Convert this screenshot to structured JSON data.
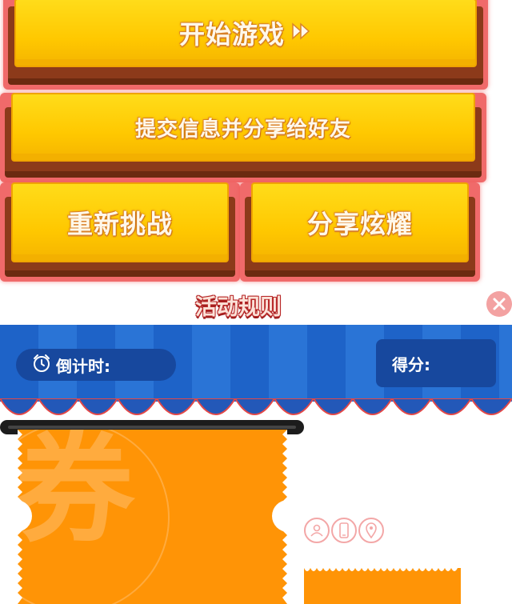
{
  "buttons": {
    "start_game": "开始游戏",
    "submit_share": "提交信息并分享给好友",
    "retry": "重新挑战",
    "share_show": "分享炫耀"
  },
  "rules_link": "活动规则",
  "header": {
    "timer_label": "倒计时:",
    "score_label": "得分:"
  },
  "coupon": {
    "seal_char": "券"
  },
  "icons": [
    "close-icon",
    "play-forward-icon",
    "alarm-clock-icon",
    "user-icon",
    "phone-icon",
    "location-icon"
  ],
  "colors": {
    "button_face": "#ffc800",
    "button_base": "#8c3a1a",
    "glow": "#f06a6a",
    "awning_blue": "#1e63c8",
    "pill_blue": "#17489e",
    "coupon_orange": "#ff9406",
    "rules_red": "#b82a2a"
  }
}
